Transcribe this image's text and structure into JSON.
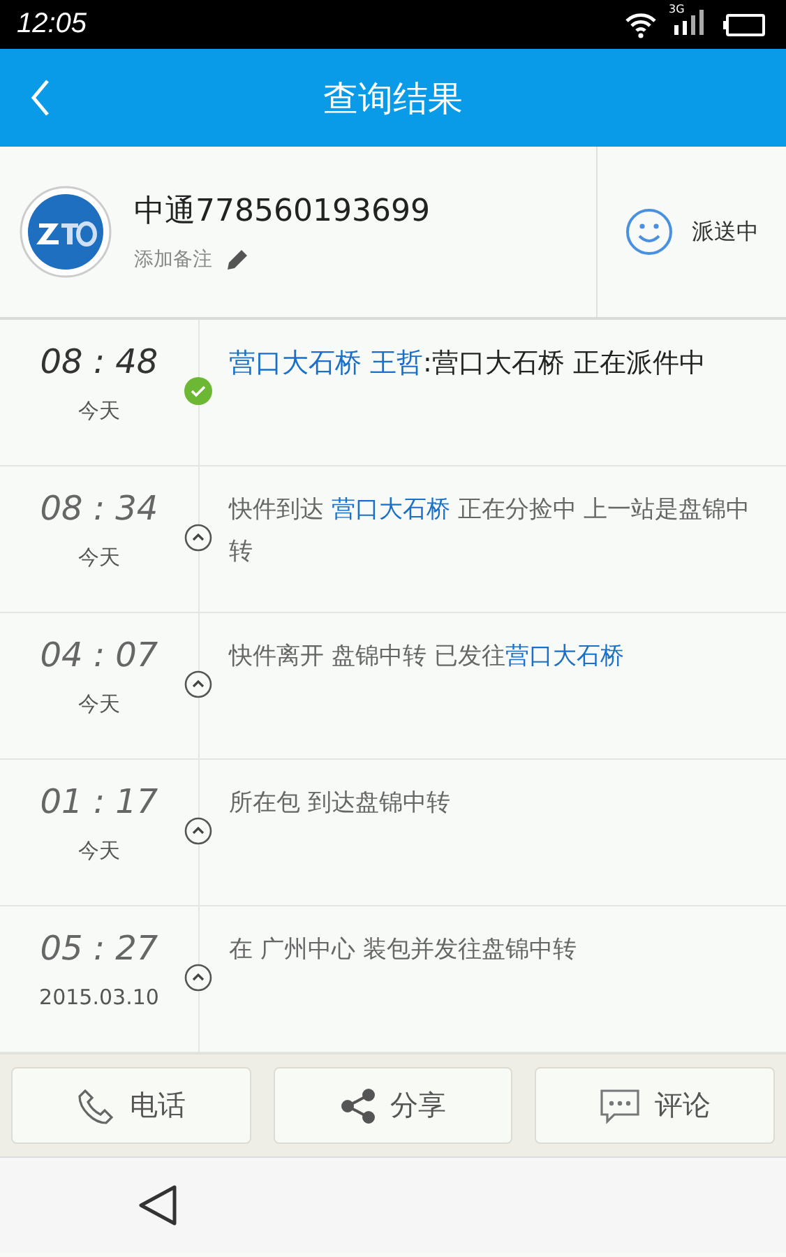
{
  "status_bar": {
    "time": "12:05",
    "network": "3G"
  },
  "header": {
    "title": "查询结果"
  },
  "parcel": {
    "name": "中通778560193699",
    "note_hint": "添加备注",
    "status": "派送中"
  },
  "events": [
    {
      "time": "08 : 48",
      "day": "今天",
      "latest": true,
      "segments": [
        {
          "text": "营口大石桥 王哲",
          "highlight": true
        },
        {
          "text": ":营口大石桥 正在派件中",
          "highlight": false
        }
      ]
    },
    {
      "time": "08 : 34",
      "day": "今天",
      "latest": false,
      "segments": [
        {
          "text": "快件到达 ",
          "highlight": false
        },
        {
          "text": "营口大石桥",
          "highlight": true
        },
        {
          "text": " 正在分捡中 上一站是盘锦中转",
          "highlight": false
        }
      ]
    },
    {
      "time": "04 : 07",
      "day": "今天",
      "latest": false,
      "segments": [
        {
          "text": "快件离开 盘锦中转 已发往",
          "highlight": false
        },
        {
          "text": "营口大石桥",
          "highlight": true
        }
      ]
    },
    {
      "time": "01 : 17",
      "day": "今天",
      "latest": false,
      "segments": [
        {
          "text": "所在包 到达盘锦中转",
          "highlight": false
        }
      ]
    },
    {
      "time": "05 : 27",
      "day": "2015.03.10",
      "latest": false,
      "segments": [
        {
          "text": "在 广州中心 装包并发往盘锦中转",
          "highlight": false
        }
      ]
    }
  ],
  "actions": [
    {
      "kind": "phone",
      "label": "电话"
    },
    {
      "kind": "share",
      "label": "分享"
    },
    {
      "kind": "comment",
      "label": "评论"
    }
  ]
}
